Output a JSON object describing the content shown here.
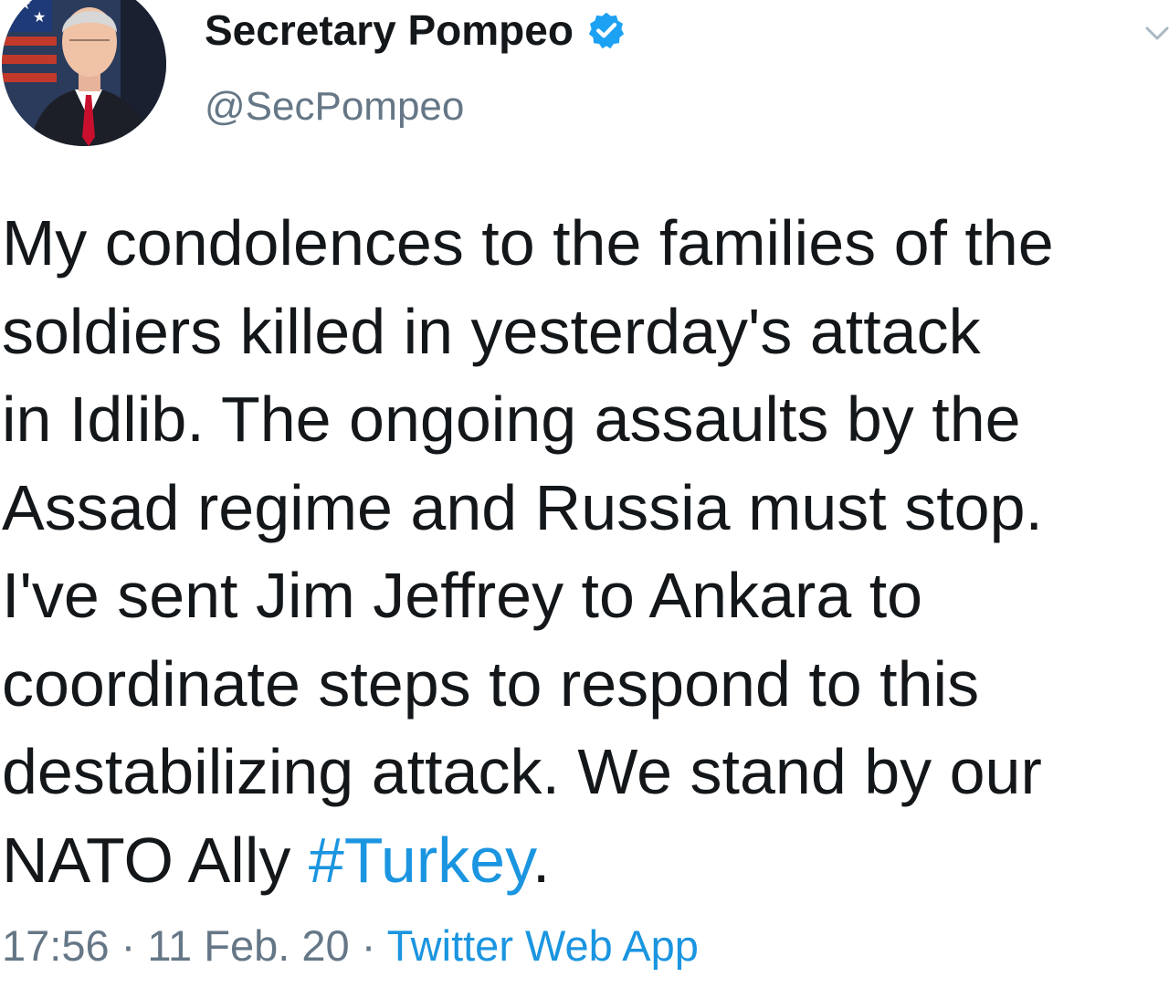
{
  "user": {
    "display_name": "Secretary Pompeo",
    "handle": "@SecPompeo",
    "verified_icon": "verified-badge-icon",
    "verified_color": "#1da1f2"
  },
  "tweet": {
    "lines": [
      "My condolences to the families of the",
      "soldiers killed in yesterday's attack",
      "in Idlib. The ongoing assaults by the",
      "Assad regime and Russia must stop.",
      "I've sent Jim Jeffrey to Ankara to",
      "coordinate steps to respond to this",
      "destabilizing attack. We stand by our"
    ],
    "last_line_prefix": "NATO Ally ",
    "hashtag": "#Turkey",
    "last_line_suffix": "."
  },
  "meta": {
    "time": "17:56",
    "separator": " · ",
    "date": "11 Feb. 20",
    "source": "Twitter Web App"
  },
  "colors": {
    "text": "#14171a",
    "secondary": "#657786",
    "link": "#1b95e0"
  }
}
